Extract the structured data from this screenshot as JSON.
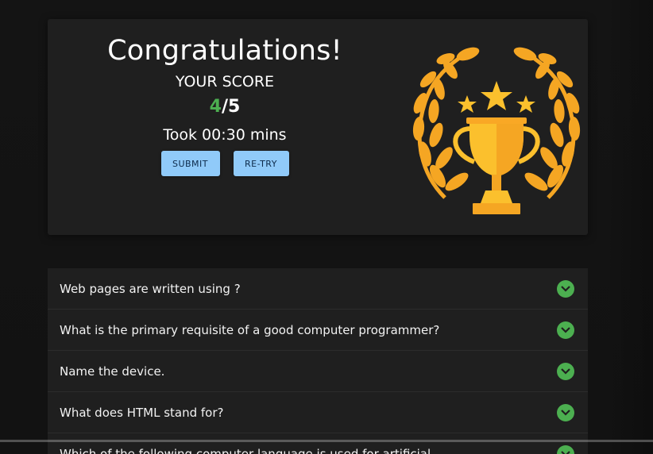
{
  "result": {
    "heading": "Congratulations!",
    "score_label": "YOUR SCORE",
    "score_correct": "4",
    "score_separator": "/",
    "score_total": "5",
    "time_text": "Took 00:30 mins",
    "submit_label": "SUBMIT",
    "retry_label": "RE-TRY"
  },
  "colors": {
    "correct": "#4caf50",
    "button_bg": "#90caf9",
    "trophy": "#f5a623"
  },
  "icons": {
    "trophy": "trophy-icon",
    "expand": "chevron-down-icon"
  },
  "questions": [
    {
      "text": "Web pages are written using ?"
    },
    {
      "text": "What is the primary requisite of a good computer programmer?"
    },
    {
      "text": "Name the device."
    },
    {
      "text": "What does HTML stand for?"
    },
    {
      "text": "Which of the following computer language is used for artificial"
    }
  ]
}
